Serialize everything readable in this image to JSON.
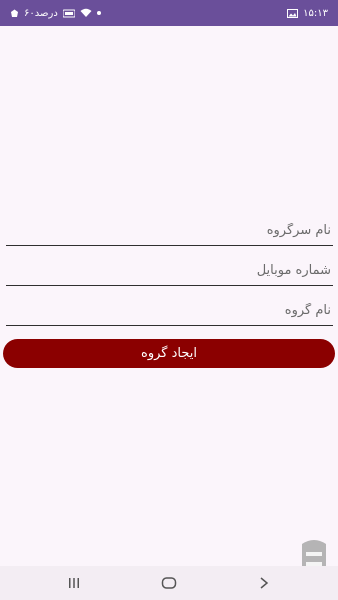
{
  "status_bar": {
    "time": "۱۵:۱۳",
    "battery_text": "۶۰درصد",
    "background_color": "#6a4f9a"
  },
  "form": {
    "leader_name_placeholder": "نام سرگروه",
    "mobile_placeholder": "شماره موبایل",
    "group_name_placeholder": "نام گروه"
  },
  "create_button": {
    "label": "ایجاد گروه",
    "color": "#8b0000"
  },
  "icons": {
    "status_left": [
      "recycle-icon",
      "battery-icon",
      "volte-icon",
      "wifi-icon",
      "dot-icon"
    ],
    "status_right": [
      "gallery-icon"
    ],
    "nav": [
      "recents-icon",
      "home-icon",
      "back-icon"
    ]
  }
}
